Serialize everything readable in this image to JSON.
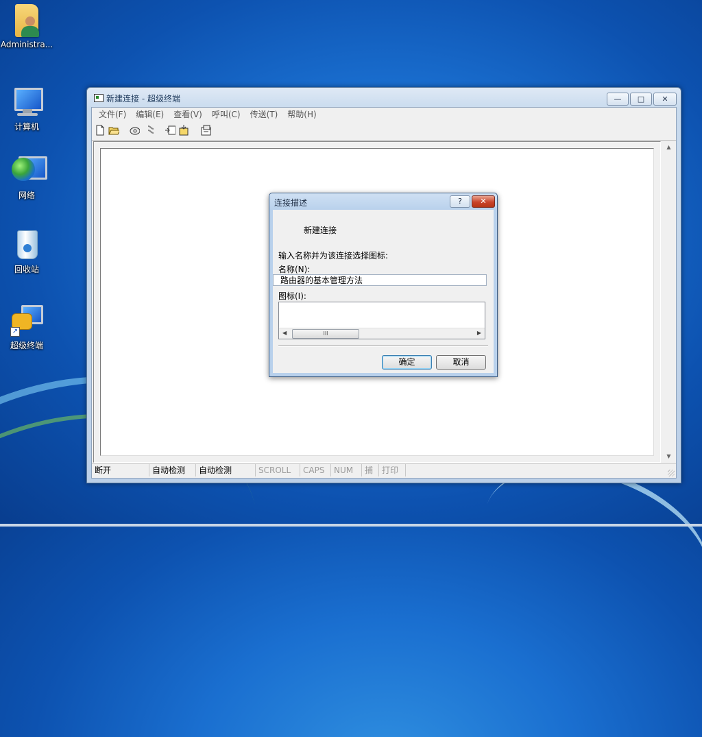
{
  "desktop": {
    "icons": [
      {
        "label": "Administra..."
      },
      {
        "label": "计算机"
      },
      {
        "label": "网络"
      },
      {
        "label": "回收站"
      },
      {
        "label": "超级终端"
      }
    ]
  },
  "window": {
    "title": "新建连接 - 超级终端",
    "controls": {
      "minimize": "—",
      "maximize": "□",
      "close": "✕"
    },
    "menu": [
      "文件(F)",
      "编辑(E)",
      "查看(V)",
      "呼叫(C)",
      "传送(T)",
      "帮助(H)"
    ],
    "toolbar": [
      "new-icon",
      "open-icon",
      "call-icon",
      "disconnect-icon",
      "send-icon",
      "receive-icon",
      "properties-icon"
    ],
    "statusbar": {
      "connection": "断开",
      "detect1": "自动检测",
      "detect2": "自动检测",
      "scroll": "SCROLL",
      "caps": "CAPS",
      "num": "NUM",
      "capture": "捕",
      "print": "打印"
    }
  },
  "dialog": {
    "title": "连接描述",
    "help_button": "?",
    "close_button": "✕",
    "heading": "新建连接",
    "prompt": "输入名称并为该连接选择图标:",
    "name_label": "名称(N):",
    "name_value": "路由器的基本管理方法",
    "icon_label": "图标(I):",
    "scroll_thumb": "III",
    "ok_label": "确定",
    "cancel_label": "取消"
  }
}
